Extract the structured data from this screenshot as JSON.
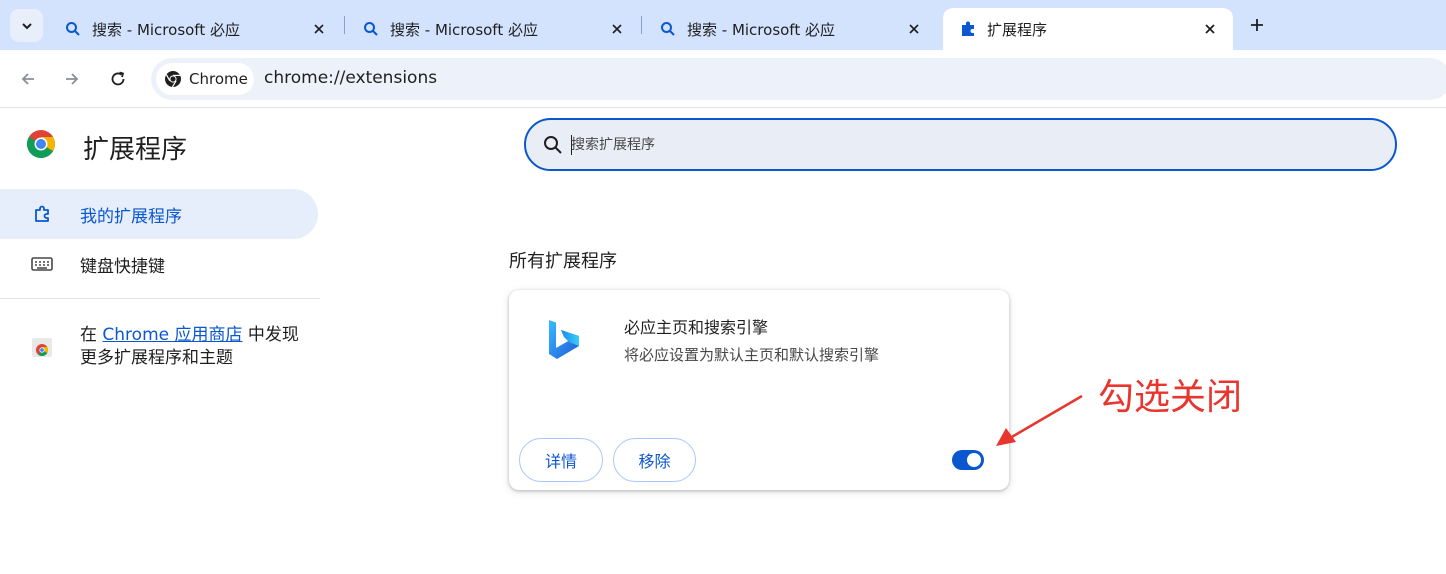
{
  "tabs": [
    {
      "title": "搜索 - Microsoft 必应",
      "icon": "search-icon"
    },
    {
      "title": "搜索 - Microsoft 必应",
      "icon": "search-icon"
    },
    {
      "title": "搜索 - Microsoft 必应",
      "icon": "search-icon"
    },
    {
      "title": "扩展程序",
      "icon": "puzzle-icon",
      "active": true
    }
  ],
  "toolbar": {
    "chip_label": "Chrome",
    "url": "chrome://extensions"
  },
  "sidebar": {
    "title": "扩展程序",
    "items": [
      {
        "label": "我的扩展程序",
        "icon": "puzzle-outline-icon",
        "selected": true
      },
      {
        "label": "键盘快捷键",
        "icon": "keyboard-icon"
      }
    ],
    "store": {
      "prefix": "在 ",
      "link": "Chrome 应用商店",
      "suffix": " 中发现更多扩展程序和主题"
    }
  },
  "search": {
    "placeholder": "搜索扩展程序"
  },
  "main": {
    "section_title": "所有扩展程序",
    "extension": {
      "name": "必应主页和搜索引擎",
      "description": "将必应设置为默认主页和默认搜索引擎",
      "details_label": "详情",
      "remove_label": "移除",
      "enabled": true
    }
  },
  "annotation": {
    "text": "勾选关闭",
    "color": "#e8362e"
  },
  "colors": {
    "accent": "#0b57d0",
    "tabstrip": "#d3e3fd"
  }
}
